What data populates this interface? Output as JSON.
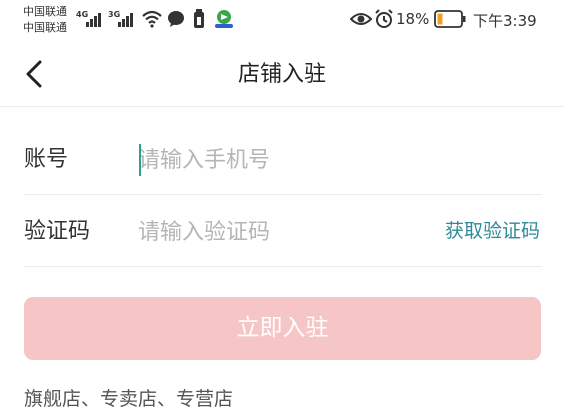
{
  "status_bar": {
    "carrier_1": "中国联通",
    "carrier_2": "中国联通",
    "net_1": "4G",
    "net_2": "3G",
    "battery_percent": "18%",
    "time": "下午3:39",
    "icons": [
      "signal-icon",
      "wifi-icon",
      "chat-icon",
      "battery-saver-icon",
      "app-icon",
      "eye-icon",
      "alarm-icon",
      "battery-icon"
    ]
  },
  "header": {
    "title": "店铺入驻",
    "back_icon": "chevron-left-icon"
  },
  "form": {
    "account_label": "账号",
    "account_placeholder": "请输入手机号",
    "code_label": "验证码",
    "code_placeholder": "请输入验证码",
    "get_code_label": "获取验证码"
  },
  "submit_label": "立即入驻",
  "shop_types": "旗舰店、专卖店、专营店",
  "colors": {
    "accent": "#2e8b99",
    "caret": "#2aa38a",
    "button_bg": "#f6c6c6",
    "battery_fill": "#f0a020"
  }
}
